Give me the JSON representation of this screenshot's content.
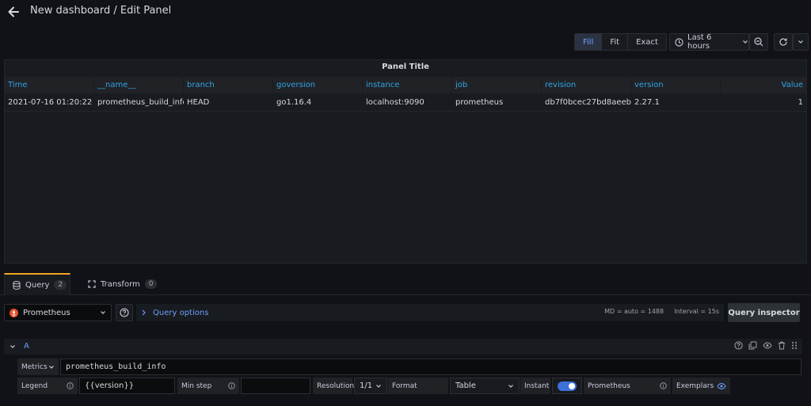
{
  "header": {
    "title": "New dashboard / Edit Panel"
  },
  "toolbar": {
    "fill_label": "Fill",
    "fit_label": "Fit",
    "exact_label": "Exact",
    "time_range_label": "Last 6 hours",
    "icons": [
      "clock-icon",
      "chevron-down-icon",
      "zoom-out-icon",
      "refresh-icon",
      "chevron-down-icon"
    ]
  },
  "panel": {
    "title": "Panel Title",
    "columns": [
      "Time",
      "__name__",
      "branch",
      "goversion",
      "instance",
      "job",
      "revision",
      "version",
      "Value"
    ],
    "rows": [
      [
        "2021-07-16 01:20:22",
        "prometheus_build_info",
        "HEAD",
        "go1.16.4",
        "localhost:9090",
        "prometheus",
        "db7f0bcec27bd8aeeb…",
        "2.27.1",
        "1"
      ]
    ]
  },
  "tabs": {
    "query_label": "Query",
    "query_count": "2",
    "transform_label": "Transform",
    "transform_count": "0"
  },
  "query_bar": {
    "datasource": "Prometheus",
    "options_label": "Query options",
    "md_info": "MD = auto = 1488",
    "interval_info": "Interval = 15s",
    "inspector_label": "Query inspector"
  },
  "query_a": {
    "letter": "A",
    "metrics_label": "Metrics",
    "metrics_value": "prometheus_build_info",
    "legend_label": "Legend",
    "legend_value": "{{version}}",
    "minstep_label": "Min step",
    "minstep_value": "",
    "resolution_label": "Resolution",
    "resolution_value": "1/1",
    "format_label": "Format",
    "format_value": "Table",
    "instant_label": "Instant",
    "instant_on": true,
    "prometheus_label": "Prometheus",
    "exemplars_label": "Exemplars"
  },
  "colors": {
    "accent_blue": "#33a2e5",
    "link_blue": "#6e9fff",
    "tab_accent": "#f5a623",
    "background": "#111217",
    "panel": "#181b1f"
  }
}
